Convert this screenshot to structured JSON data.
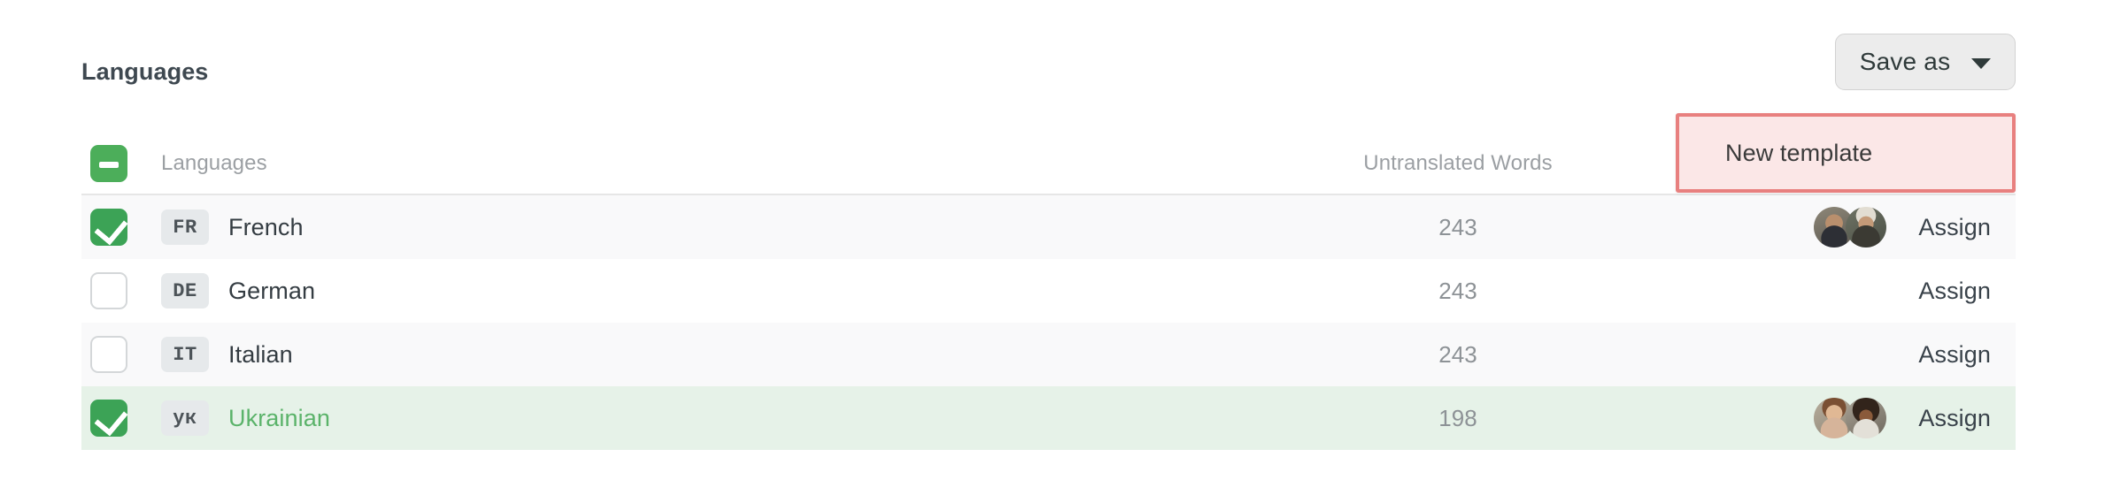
{
  "panel": {
    "title": "Languages"
  },
  "toolbar": {
    "save_as_label": "Save as",
    "caret_icon": "chevron-down-icon",
    "dropdown": {
      "open": true,
      "items": [
        {
          "label": "New template",
          "highlighted": true
        }
      ],
      "highlight_border_color": "#e8807f",
      "highlight_bg_color": "#fbe7e7"
    }
  },
  "table": {
    "select_all_state": "indeterminate",
    "columns": [
      {
        "key": "languages",
        "label": "Languages"
      },
      {
        "key": "untranslated_words",
        "label": "Untranslated Words"
      },
      {
        "key": "assign",
        "label": ""
      }
    ],
    "rows": [
      {
        "code": "FR",
        "name": "French",
        "untranslated_words": "243",
        "checked": true,
        "highlighted": false,
        "stripe": "odd",
        "assign_label": "Assign",
        "avatars": [
          "avatar-male-glasses",
          "avatar-male-hat"
        ]
      },
      {
        "code": "DE",
        "name": "German",
        "untranslated_words": "243",
        "checked": false,
        "highlighted": false,
        "stripe": "even",
        "assign_label": "Assign",
        "avatars": []
      },
      {
        "code": "IT",
        "name": "Italian",
        "untranslated_words": "243",
        "checked": false,
        "highlighted": false,
        "stripe": "odd",
        "assign_label": "Assign",
        "avatars": []
      },
      {
        "code": "ук",
        "name": "Ukrainian",
        "untranslated_words": "198",
        "checked": true,
        "highlighted": true,
        "stripe": "selected-green",
        "assign_label": "Assign",
        "avatars": [
          "avatar-female-long-hair",
          "avatar-female-curly-hair"
        ]
      }
    ]
  },
  "colors": {
    "accent_green": "#3ca356",
    "row_highlight_green": "#e6f2e8",
    "lang_highlight_text": "#5bb36a",
    "stripe_gray": "#f9f9fa",
    "border_gray": "#e6e6e6",
    "badge_bg": "#e6e9eb",
    "muted_text": "#9b9fa3",
    "value_text": "#8d9296",
    "title_text": "#3e4850"
  }
}
